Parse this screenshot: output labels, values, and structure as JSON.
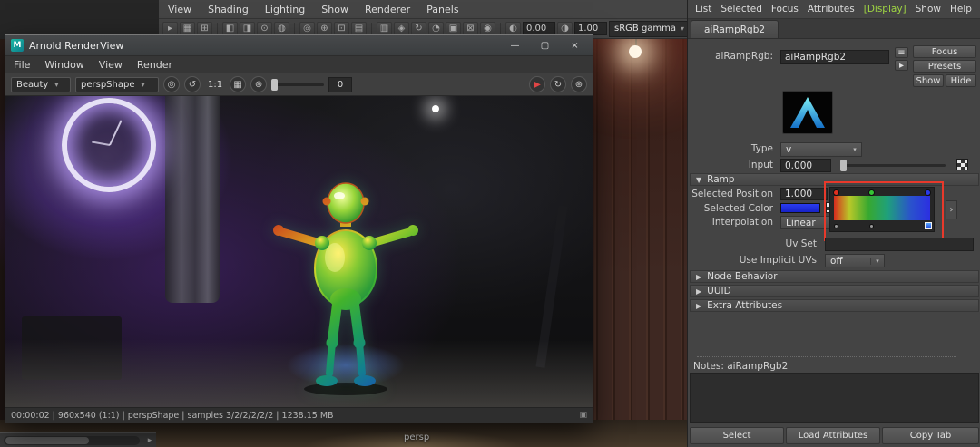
{
  "icons": {
    "maya_logo": "M",
    "minimize": "—",
    "maximize": "▢",
    "close": "×",
    "dropdown": "▾",
    "target": "◎",
    "orbit": "↺",
    "filmgate": "▦",
    "gear": "⊛",
    "play": "▶",
    "refresh": "↻",
    "section_open": "▼",
    "section_closed": "▶",
    "ramp_next": "›",
    "scroll_right": "▸",
    "grip": "▣",
    "exposure": "◐",
    "gamma": "◑",
    "node_btn_a": "≡",
    "node_btn_b": "▸"
  },
  "maya": {
    "panel_menu": [
      "View",
      "Shading",
      "Lighting",
      "Show",
      "Renderer",
      "Panels"
    ],
    "toolbar_icons": [
      "▸",
      "▦",
      "⊞",
      "◧",
      "◨",
      "⊙",
      "◍",
      "◎",
      "⊕",
      "⊡",
      "▤",
      "▥",
      "◈",
      "↻",
      "◔",
      "▣",
      "⊠",
      "◉"
    ],
    "exposure": "0.00",
    "gamma": "1.00",
    "colorspace": "sRGB gamma"
  },
  "arnold": {
    "title": "Arnold RenderView",
    "menubar": [
      "File",
      "Window",
      "View",
      "Render"
    ],
    "toolbar": {
      "aov": "Beauty",
      "camera": "perspShape",
      "zoom": "1:1",
      "slider_value": "0"
    },
    "status": "00:00:02 | 960x540 (1:1) | perspShape | samples 3/2/2/2/2/2 | 1238.15 MB"
  },
  "attribute_editor": {
    "menubar": [
      "List",
      "Selected",
      "Focus",
      "Attributes",
      "[Display]",
      "Show",
      "Help"
    ],
    "tab": "aiRampRgb2",
    "node_label": "aiRampRgb:",
    "node_value": "aiRampRgb2",
    "buttons": {
      "focus": "Focus",
      "presets": "Presets",
      "show": "Show",
      "hide": "Hide"
    },
    "type_label": "Type",
    "type_value": "v",
    "input_label": "Input",
    "input_value": "0.000",
    "ramp": {
      "title": "Ramp",
      "position_label": "Selected Position",
      "position_value": "1.000",
      "color_label": "Selected Color",
      "interp_label": "Interpolation",
      "interp_value": "Linear",
      "selected_color": "#2233e8",
      "gradient_stops": [
        "#d62b1e",
        "#b9c829",
        "#37a830",
        "#1fa07c",
        "#2a52cc",
        "#2b2fe2"
      ],
      "annotation_color": "#e8392b"
    },
    "uvset_label": "Uv Set",
    "implicit_label": "Use Implicit UVs",
    "implicit_value": "off",
    "sections": [
      "Node Behavior",
      "UUID",
      "Extra Attributes"
    ],
    "notes_label": "Notes:  aiRampRgb2",
    "bottom_buttons": [
      "Select",
      "Load Attributes",
      "Copy Tab"
    ]
  },
  "viewport": {
    "camera": "persp"
  }
}
